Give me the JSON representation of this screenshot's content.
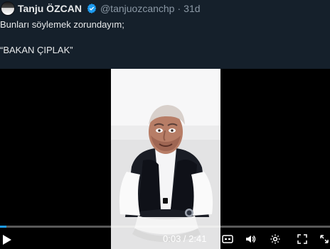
{
  "tweet": {
    "author_name": "Tanju ÖZCAN",
    "handle": "@tanjuozcanchp",
    "separator": "·",
    "timestamp": "31d",
    "text_line1": "Bunları söylemek zorundayım;",
    "text_line2": "“BAKAN ÇIPLAK”"
  },
  "video": {
    "time": "0:03 / 2:41",
    "progress": 0.02
  },
  "colors": {
    "background": "#15202b",
    "accent": "#1d9bf0",
    "secondary_text": "#8b98a5",
    "primary_text": "#e7e9ea"
  },
  "icons": {
    "verified": "verified-badge-icon",
    "play": "play-icon",
    "captions": "captions-icon",
    "volume": "volume-icon",
    "settings": "settings-icon",
    "fullscreen": "fullscreen-icon",
    "expand": "expand-icon"
  }
}
